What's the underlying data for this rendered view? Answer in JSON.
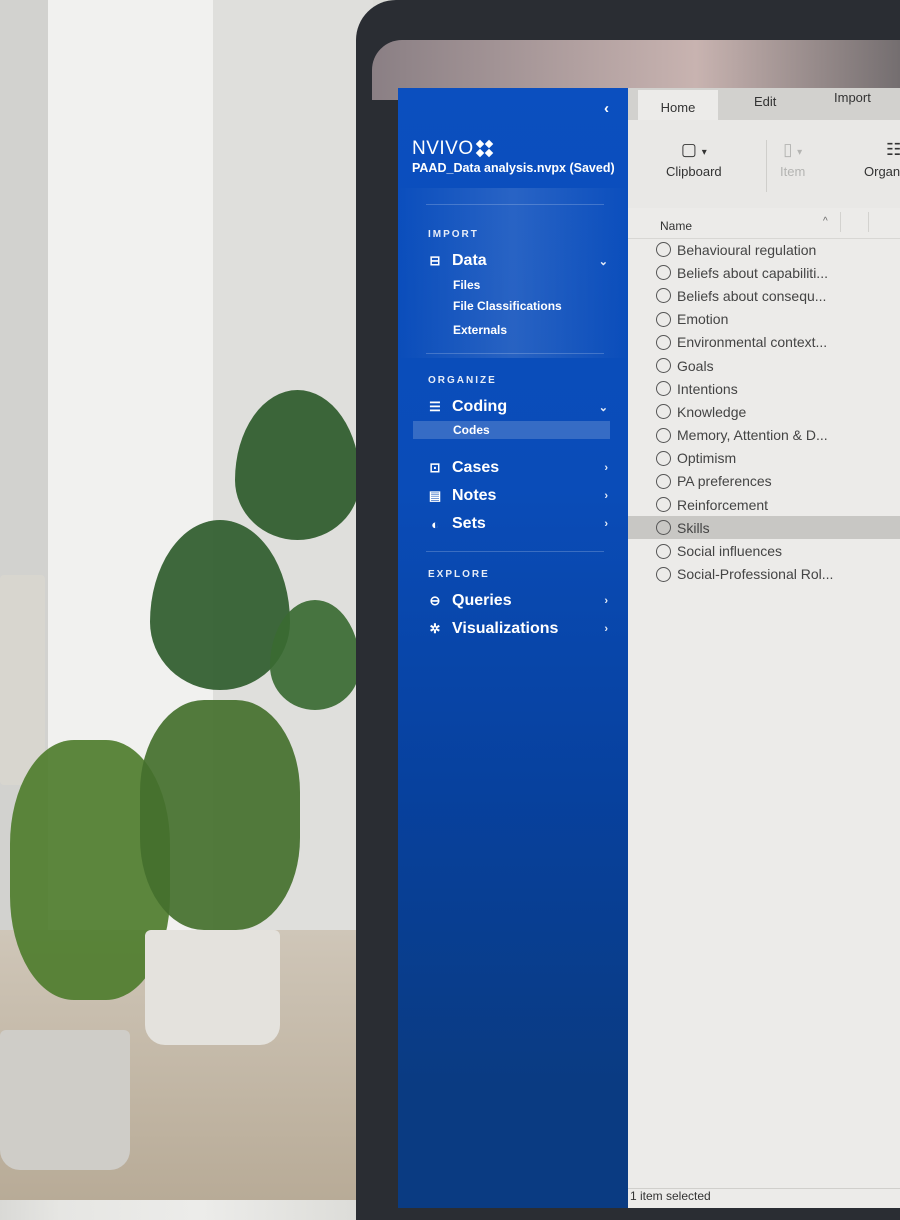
{
  "sidebar": {
    "collapse_icon": "chevron-left-icon",
    "collapse_glyph": "‹",
    "logo_text": "NVIVO",
    "project_title": "PAAD_Data analysis.nvpx (Saved)",
    "sections": {
      "import": "IMPORT",
      "organize": "ORGANIZE",
      "explore": "EXPLORE"
    },
    "items": {
      "data": {
        "label": "Data",
        "icon": "data-icon",
        "glyph": "⊟",
        "chevron": "⌄"
      },
      "files": {
        "label": "Files"
      },
      "file_classifications": {
        "label": "File Classifications"
      },
      "externals": {
        "label": "Externals"
      },
      "coding": {
        "label": "Coding",
        "icon": "coding-icon",
        "glyph": "☰",
        "chevron": "⌄"
      },
      "codes": {
        "label": "Codes"
      },
      "cases": {
        "label": "Cases",
        "icon": "cases-icon",
        "glyph": "⊡",
        "chevron": "›"
      },
      "notes": {
        "label": "Notes",
        "icon": "notes-icon",
        "glyph": "▤",
        "chevron": "›"
      },
      "sets": {
        "label": "Sets",
        "icon": "sets-icon",
        "glyph": "◐",
        "chevron": "›"
      },
      "queries": {
        "label": "Queries",
        "icon": "queries-icon",
        "glyph": "⊖",
        "chevron": "›"
      },
      "visualizations": {
        "label": "Visualizations",
        "icon": "visualizations-icon",
        "glyph": "✲",
        "chevron": "›"
      }
    }
  },
  "tabs": [
    {
      "label": "Home",
      "active": true
    },
    {
      "label": "Edit"
    },
    {
      "label": "Import"
    }
  ],
  "ribbon": {
    "clipboard": {
      "label": "Clipboard",
      "icon": "clipboard-icon",
      "glyph": "📋",
      "dropdown": "▾"
    },
    "item": {
      "label": "Item",
      "icon": "document-icon",
      "glyph": "🗋",
      "dropdown": "▾",
      "disabled": true
    },
    "organize": {
      "label": "Organ",
      "icon": "organize-icon",
      "glyph": "☷"
    }
  },
  "table": {
    "column_name": "Name",
    "sort_glyph": "^",
    "rows": [
      {
        "name": "Behavioural regulation"
      },
      {
        "name": "Beliefs about capabiliti..."
      },
      {
        "name": "Beliefs about consequ..."
      },
      {
        "name": "Emotion"
      },
      {
        "name": "Environmental context..."
      },
      {
        "name": "Goals"
      },
      {
        "name": "Intentions"
      },
      {
        "name": "Knowledge"
      },
      {
        "name": "Memory, Attention & D..."
      },
      {
        "name": "Optimism"
      },
      {
        "name": "PA preferences"
      },
      {
        "name": "Reinforcement"
      },
      {
        "name": "Skills",
        "selected": true
      },
      {
        "name": "Social influences"
      },
      {
        "name": "Social-Professional Rol..."
      }
    ]
  },
  "status": {
    "text": "1 item selected"
  }
}
